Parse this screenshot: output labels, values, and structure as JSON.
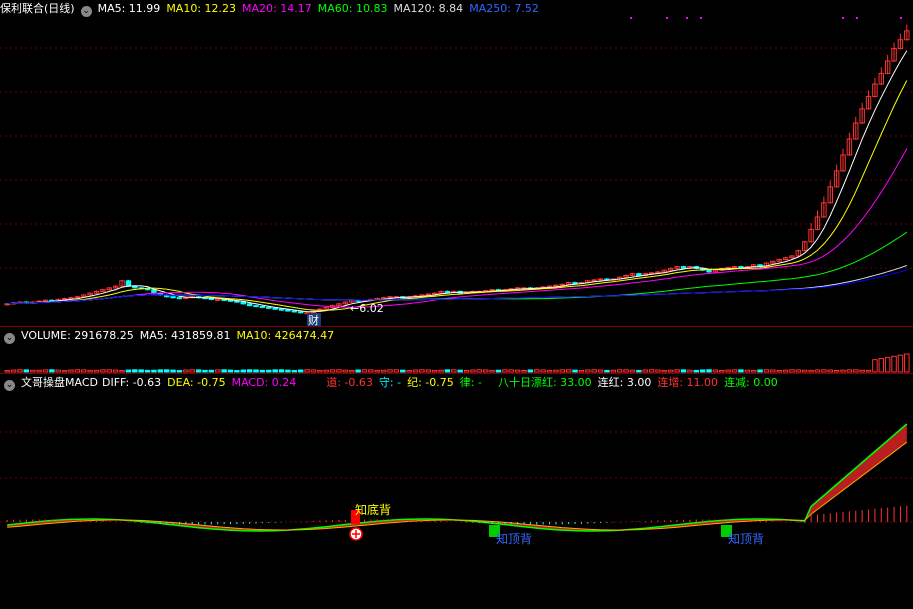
{
  "main_info": {
    "title": "保利联合(日线)",
    "ma5": "MA5: 11.99",
    "ma10": "MA10: 12.23",
    "ma20": "MA20: 14.17",
    "ma60": "MA60: 10.83",
    "ma120": "MA120: 8.84",
    "ma250": "MA250: 7.52"
  },
  "volume_info": {
    "volume": "VOLUME: 291678.25",
    "ma5": "MA5: 431859.81",
    "ma10": "MA10: 426474.47"
  },
  "macd_info": {
    "name": "文哥操盘MACD",
    "diff": "DIFF: -0.63",
    "dea": "DEA: -0.75",
    "macd": "MACD: 0.24",
    "dao": "道: -0.63",
    "shou": "守: -",
    "ji": "纪: -0.75",
    "lv": "律: -",
    "bashi": "八十日漂红: 33.00",
    "lianhong": "连红: 3.00",
    "lianzeng": "连增: 11.00",
    "lianjian": "连减: 0.00"
  },
  "annotations": {
    "low_price": "6.02",
    "cai_marker": "财",
    "bottom_div": "知底背",
    "top_div_1": "知顶背",
    "top_div_2": "知顶背"
  },
  "colors": {
    "ma5": "#ffffff",
    "ma10": "#ffff00",
    "ma20": "#ff00ff",
    "ma60": "#00ff00",
    "ma120": "#dddddd",
    "ma250": "#0000ff",
    "up": "#ff3333",
    "down": "#00ffff"
  },
  "chart_data": [
    {
      "type": "candlestick",
      "x": [
        1,
        2,
        3,
        4,
        5,
        6,
        7,
        8,
        9,
        10,
        11,
        12,
        13,
        14,
        15,
        16,
        17,
        18,
        19,
        20,
        21,
        22,
        23,
        24,
        25,
        26,
        27,
        28,
        29,
        30,
        31,
        32,
        33,
        34,
        35,
        36,
        37,
        38,
        39,
        40,
        41,
        42,
        43,
        44,
        45,
        46,
        47,
        48,
        49,
        50,
        51,
        52,
        53,
        54,
        55,
        56,
        57,
        58,
        59,
        60,
        61,
        62,
        63,
        64,
        65,
        66,
        67,
        68,
        69,
        70,
        71,
        72,
        73,
        74,
        75,
        76,
        77,
        78,
        79,
        80,
        81,
        82,
        83,
        84,
        85,
        86,
        87,
        88,
        89,
        90,
        91,
        92,
        93,
        94,
        95,
        96,
        97,
        98,
        99,
        100,
        101,
        102,
        103,
        104,
        105,
        106,
        107,
        108,
        109,
        110,
        111,
        112,
        113,
        114,
        115,
        116,
        117,
        118,
        119,
        120,
        121,
        122,
        123,
        124,
        125,
        126,
        127,
        128,
        129,
        130,
        131,
        132,
        133,
        134,
        135,
        136,
        137,
        138,
        139,
        140,
        141,
        142,
        143,
        144,
        145,
        146,
        147,
        148,
        149,
        150
      ],
      "close": [
        6.6,
        6.65,
        6.7,
        6.65,
        6.7,
        6.75,
        6.8,
        6.75,
        6.85,
        6.9,
        6.95,
        7.0,
        7.1,
        7.2,
        7.3,
        7.4,
        7.5,
        7.6,
        7.9,
        7.6,
        7.5,
        7.45,
        7.4,
        7.2,
        7.1,
        7.0,
        6.95,
        6.9,
        6.95,
        7.0,
        6.95,
        6.9,
        6.85,
        6.85,
        6.8,
        6.75,
        6.7,
        6.6,
        6.5,
        6.45,
        6.4,
        6.35,
        6.3,
        6.25,
        6.2,
        6.15,
        6.1,
        6.1,
        6.2,
        6.3,
        6.4,
        6.5,
        6.6,
        6.7,
        6.8,
        6.75,
        6.8,
        6.85,
        6.9,
        6.95,
        7.0,
        7.0,
        6.95,
        7.0,
        7.05,
        7.1,
        7.15,
        7.2,
        7.3,
        7.25,
        7.3,
        7.2,
        7.25,
        7.3,
        7.3,
        7.35,
        7.4,
        7.35,
        7.4,
        7.45,
        7.5,
        7.5,
        7.45,
        7.5,
        7.55,
        7.6,
        7.65,
        7.7,
        7.8,
        7.75,
        7.8,
        7.9,
        7.95,
        8.0,
        7.95,
        8.0,
        8.1,
        8.2,
        8.3,
        8.2,
        8.3,
        8.35,
        8.4,
        8.5,
        8.6,
        8.7,
        8.6,
        8.7,
        8.6,
        8.5,
        8.4,
        8.5,
        8.6,
        8.65,
        8.7,
        8.6,
        8.7,
        8.8,
        8.7,
        8.9,
        9.0,
        9.1,
        9.2,
        9.3,
        9.6,
        10.1,
        10.8,
        11.5,
        12.3,
        13.2,
        14.1,
        15.0,
        15.9,
        16.8,
        17.6,
        18.3,
        19.0,
        19.6,
        20.3,
        21.0,
        21.5,
        22.0
      ],
      "ylim": [
        6.02,
        22.0
      ],
      "annotations": [
        "6.02"
      ]
    },
    {
      "type": "bar",
      "name": "VOLUME",
      "values": [
        291678.25
      ],
      "ylim": [
        0,
        1000000
      ]
    },
    {
      "type": "line",
      "name": "MACD",
      "series": [
        {
          "name": "DIFF",
          "values": [
            -0.63
          ]
        },
        {
          "name": "DEA",
          "values": [
            -0.75
          ]
        },
        {
          "name": "MACD",
          "values": [
            0.24
          ]
        }
      ]
    }
  ]
}
